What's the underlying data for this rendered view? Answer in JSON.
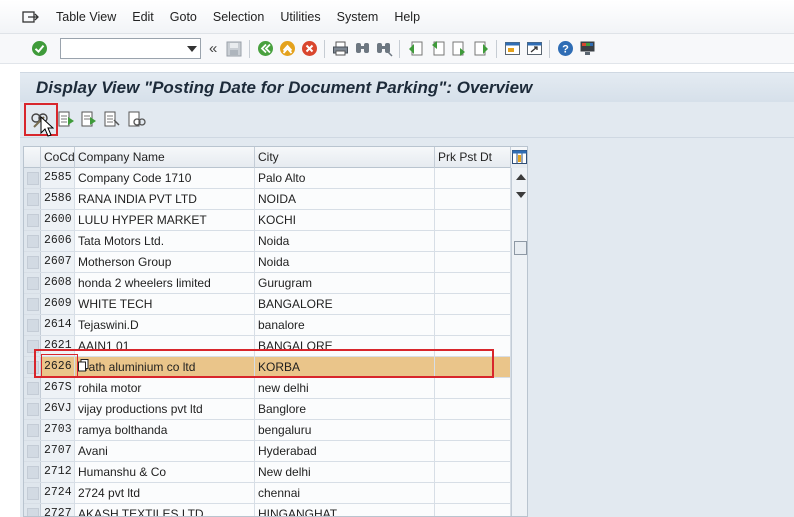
{
  "menu": {
    "items": [
      "Table View",
      "Edit",
      "Goto",
      "Selection",
      "Utilities",
      "System",
      "Help"
    ]
  },
  "toolbar": {
    "command_value": "",
    "icons": [
      "enter-icon",
      "command-field",
      "save-icon",
      "back-icon",
      "exit-icon",
      "cancel-icon",
      "print-icon",
      "find-icon",
      "find-next-icon",
      "first-page-icon",
      "previous-page-icon",
      "next-page-icon",
      "last-page-icon",
      "new-session-icon",
      "shortcut-icon",
      "help-icon",
      "customize-layout-icon"
    ]
  },
  "title": "Display View \"Posting Date for Document Parking\": Overview",
  "table": {
    "columns": [
      "CoCd",
      "Company Name",
      "City",
      "Prk Pst Dt"
    ],
    "rows": [
      {
        "cocd": "2585",
        "name": "Company Code 1710",
        "city": "Palo Alto",
        "date": ""
      },
      {
        "cocd": "2586",
        "name": "RANA INDIA PVT LTD",
        "city": "NOIDA",
        "date": ""
      },
      {
        "cocd": "2600",
        "name": "LULU HYPER MARKET",
        "city": "KOCHI",
        "date": ""
      },
      {
        "cocd": "2606",
        "name": "Tata Motors Ltd.",
        "city": "Noida",
        "date": ""
      },
      {
        "cocd": "2607",
        "name": "Motherson Group",
        "city": "Noida",
        "date": ""
      },
      {
        "cocd": "2608",
        "name": "honda 2 wheelers limited",
        "city": "Gurugram",
        "date": ""
      },
      {
        "cocd": "2609",
        "name": "WHITE TECH",
        "city": "BANGALORE",
        "date": ""
      },
      {
        "cocd": "2614",
        "name": "Tejaswini.D",
        "city": "banalore",
        "date": ""
      },
      {
        "cocd": "2621",
        "name": "AAIN1 01",
        "city": "BANGALORE",
        "date": ""
      },
      {
        "cocd": "2626",
        "name": "arath aluminium co ltd",
        "city": "KORBA",
        "date": ""
      },
      {
        "cocd": "267S",
        "name": "rohila motor",
        "city": "new delhi",
        "date": ""
      },
      {
        "cocd": "26VJ",
        "name": "vijay productions pvt ltd",
        "city": "Banglore",
        "date": ""
      },
      {
        "cocd": "2703",
        "name": "ramya bolthanda",
        "city": "bengaluru",
        "date": ""
      },
      {
        "cocd": "2707",
        "name": "Avani",
        "city": "Hyderabad",
        "date": ""
      },
      {
        "cocd": "2712",
        "name": "Humanshu & Co",
        "city": "New delhi",
        "date": ""
      },
      {
        "cocd": "2724",
        "name": "2724 pvt ltd",
        "city": "chennai",
        "date": ""
      },
      {
        "cocd": "2727",
        "name": "AKASH TEXTILES LTD",
        "city": "HINGANGHAT",
        "date": ""
      }
    ],
    "selected_row": 9
  },
  "colors": {
    "selected_row": "#eac58a",
    "highlight_box": "#d8262c",
    "title_bg": "#d6e0ea"
  }
}
